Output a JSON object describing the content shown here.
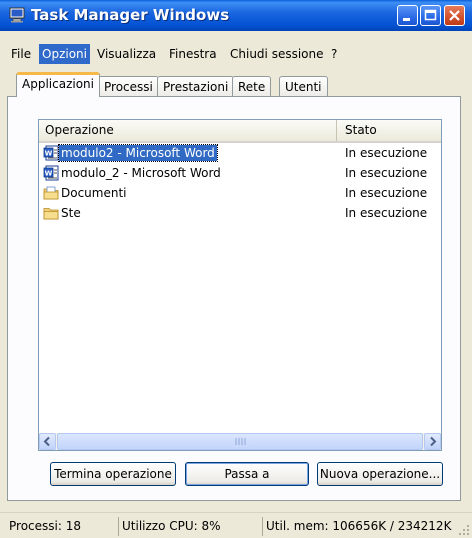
{
  "window": {
    "title": "Task Manager Windows"
  },
  "menu": [
    {
      "label": "File",
      "key": "F"
    },
    {
      "label": "Opzioni",
      "key": "O",
      "selected": true
    },
    {
      "label": "Visualizza",
      "key": "V"
    },
    {
      "label": "Finestra",
      "key": "i"
    },
    {
      "label": "Chiudi sessione",
      "key": "C"
    },
    {
      "label": "?",
      "key": "?"
    }
  ],
  "tabs": [
    {
      "label": "Applicazioni",
      "active": true
    },
    {
      "label": "Processi"
    },
    {
      "label": "Prestazioni"
    },
    {
      "label": "Rete"
    },
    {
      "label": "Utenti"
    }
  ],
  "list": {
    "columns": [
      "Operazione",
      "Stato"
    ],
    "rows": [
      {
        "name": "modulo2 - Microsoft Word",
        "status": "In esecuzione",
        "icon": "word-document-icon",
        "selected": true
      },
      {
        "name": "modulo_2 - Microsoft Word",
        "status": "In esecuzione",
        "icon": "word-document-icon"
      },
      {
        "name": "Documenti",
        "status": "In esecuzione",
        "icon": "folder-documents-icon"
      },
      {
        "name": "Ste",
        "status": "In esecuzione",
        "icon": "folder-icon"
      }
    ]
  },
  "buttons": {
    "end_task": "Termina operazione",
    "switch_to": "Passa a",
    "new_task": "Nuova operazione..."
  },
  "status": {
    "processes": "Processi: 18",
    "cpu": "Utilizzo CPU: 8%",
    "memory": "Util. mem: 106656K / 234212K"
  },
  "colors": {
    "titlebar": "#0553d4",
    "selection": "#316ac5",
    "active_tab_accent": "#f6b84a",
    "close_button": "#d2512c"
  }
}
